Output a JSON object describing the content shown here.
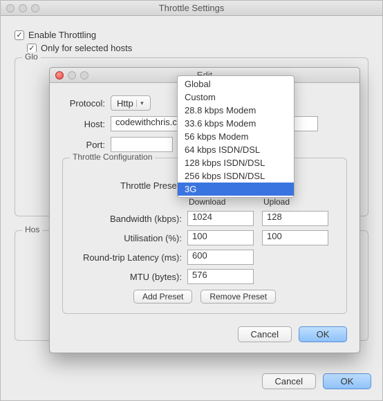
{
  "window": {
    "title": "Throttle Settings",
    "enable_throttling_label": "Enable Throttling",
    "only_selected_hosts_label": "Only for selected hosts",
    "group_glo_legend": "Glo",
    "group_hos_legend": "Hos",
    "footer_cancel": "Cancel",
    "footer_ok": "OK"
  },
  "modal": {
    "title": "Edit",
    "protocol_label": "Protocol:",
    "protocol_value": "Http",
    "host_label": "Host:",
    "host_value": "codewithchris.c",
    "port_label": "Port:",
    "port_value": "",
    "group_legend": "Throttle Configuration",
    "preset_label": "Throttle Preset:",
    "preset_value": "3G",
    "col_download": "Download",
    "col_upload": "Upload",
    "bandwidth_label": "Bandwidth (kbps):",
    "bandwidth_download": "1024",
    "bandwidth_upload": "128",
    "utilisation_label": "Utilisation (%):",
    "utilisation_download": "100",
    "utilisation_upload": "100",
    "latency_label": "Round-trip Latency (ms):",
    "latency_value": "600",
    "mtu_label": "MTU (bytes):",
    "mtu_value": "576",
    "add_preset_label": "Add Preset",
    "remove_preset_label": "Remove Preset",
    "cancel_label": "Cancel",
    "ok_label": "OK"
  },
  "dropdown": {
    "items": [
      "Global",
      "Custom",
      "28.8 kbps Modem",
      "33.6 kbps Modem",
      "56 kbps Modem",
      "64 kbps ISDN/DSL",
      "128 kbps ISDN/DSL",
      "256 kbps ISDN/DSL",
      "3G"
    ],
    "selected": "3G"
  }
}
